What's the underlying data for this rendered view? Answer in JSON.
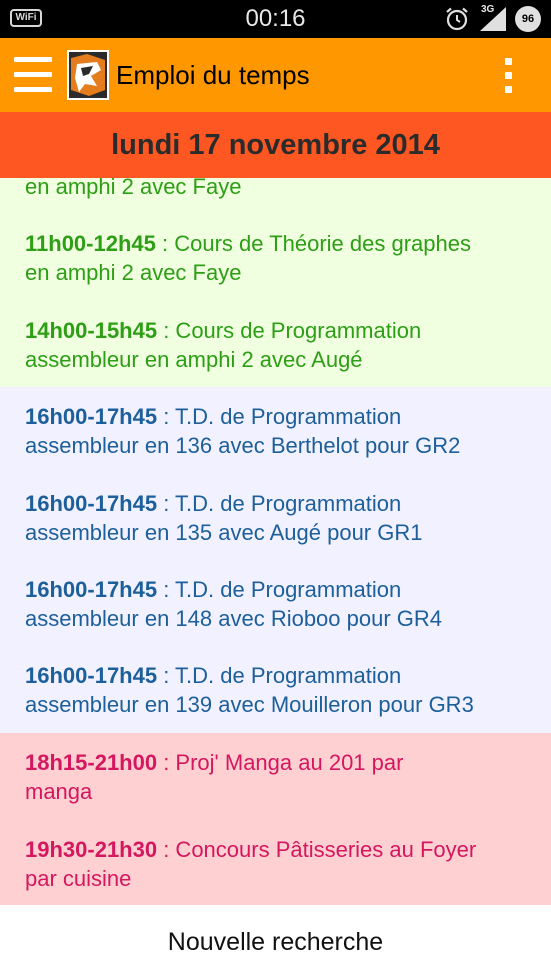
{
  "status_bar": {
    "wifi_label": "WiFi",
    "time": "00:16",
    "network_label": "3G",
    "battery_level": "96"
  },
  "app_bar": {
    "title": "Emploi du temps"
  },
  "date_header": "lundi 17 novembre 2014",
  "schedule": {
    "green": [
      {
        "time": "",
        "line1": "en amphi 2 avec Faye",
        "line2": ""
      },
      {
        "time": "11h00-12h45",
        "line1": " : Cours de Théorie des graphes",
        "line2": "en amphi 2 avec Faye"
      },
      {
        "time": "14h00-15h45",
        "line1": " : Cours de Programmation",
        "line2": "assembleur en amphi 2 avec Augé"
      }
    ],
    "blue": [
      {
        "time": "16h00-17h45",
        "line1": " : T.D. de Programmation",
        "line2": "assembleur en 136 avec Berthelot pour GR2"
      },
      {
        "time": "16h00-17h45",
        "line1": " : T.D. de Programmation",
        "line2": "assembleur en 135 avec Augé pour GR1"
      },
      {
        "time": "16h00-17h45",
        "line1": " : T.D. de Programmation",
        "line2": "assembleur en 148 avec Rioboo pour GR4"
      },
      {
        "time": "16h00-17h45",
        "line1": " : T.D. de Programmation",
        "line2": "assembleur en 139 avec Mouilleron pour GR3"
      }
    ],
    "red": [
      {
        "time": "18h15-21h00",
        "line1": " : Proj' Manga au 201 par",
        "line2": "manga"
      },
      {
        "time": "19h30-21h30",
        "line1": " : Concours Pâtisseries au Foyer",
        "line2": "par cuisine"
      }
    ]
  },
  "new_search_label": "Nouvelle recherche",
  "colors": {
    "app_bar": "#ff9800",
    "date_header": "#ff5722",
    "green_bg": "#efffdf",
    "green_text": "#2e9e16",
    "blue_bg": "#f1f1ff",
    "blue_text": "#1d5f9a",
    "red_bg": "#ffd0d2",
    "red_text": "#d4175f"
  },
  "icons": {
    "menu": "hamburger-menu-icon",
    "logo": "university-shield-logo",
    "overflow": "vertical-dots-icon",
    "alarm": "alarm-clock-icon",
    "signal": "signal-bars-icon"
  }
}
